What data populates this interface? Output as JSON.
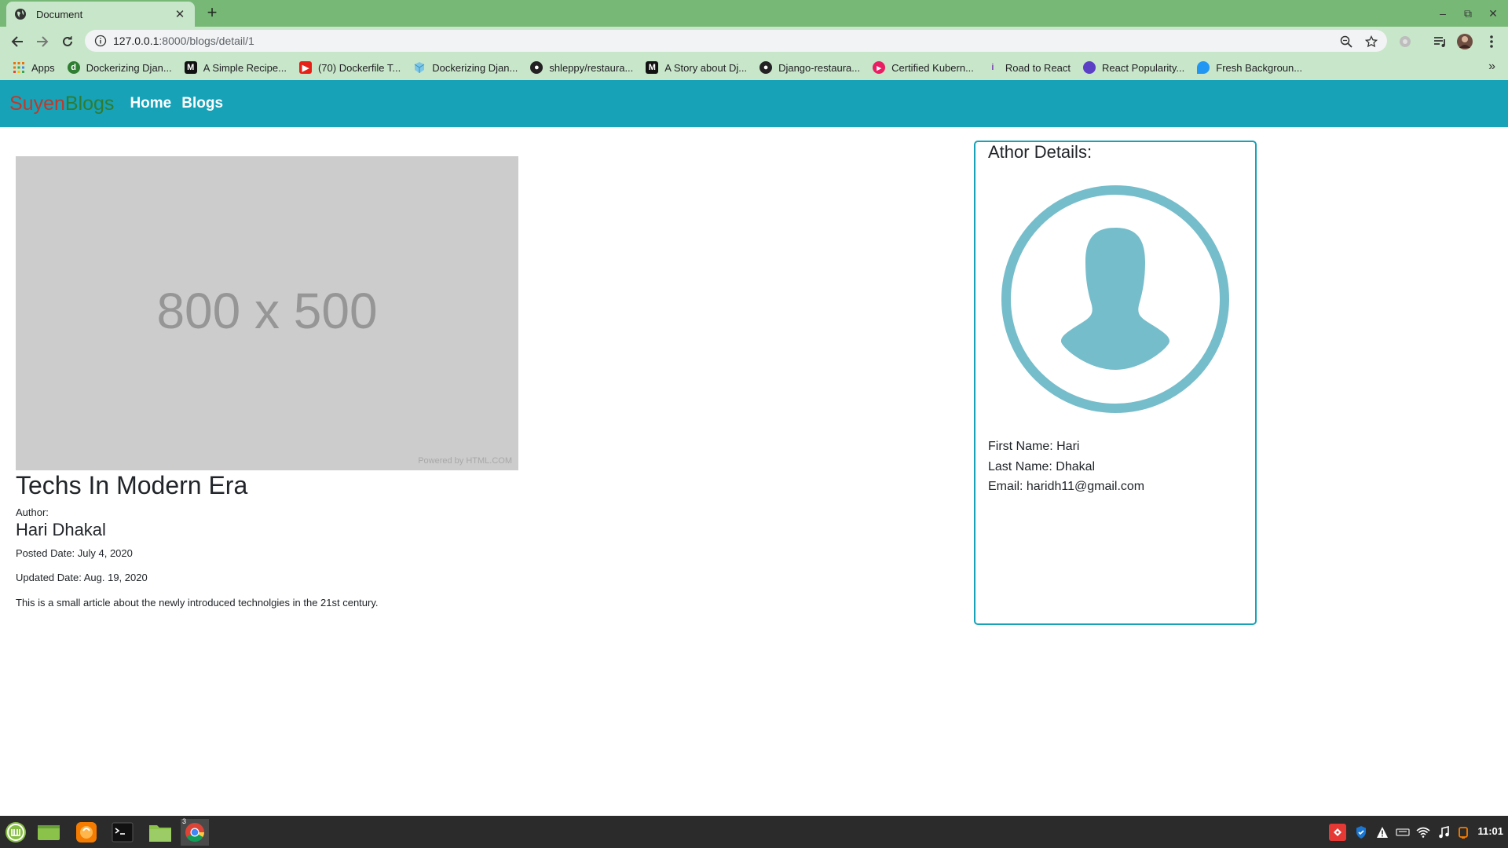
{
  "browser": {
    "tab_title": "Document",
    "url_host": "127.0.0.1",
    "url_rest": ":8000/blogs/detail/1",
    "bookmarks": [
      {
        "label": "Apps",
        "icon": "apps-grid-icon",
        "color": "#e8710a"
      },
      {
        "label": "Dockerizing Djan...",
        "icon": "green-logo-icon",
        "color": "#2e7d32"
      },
      {
        "label": "A Simple Recipe...",
        "icon": "medium-icon",
        "color": "#111111"
      },
      {
        "label": "(70) Dockerfile T...",
        "icon": "youtube-icon",
        "color": "#e62117"
      },
      {
        "label": "Dockerizing Djan...",
        "icon": "cube-icon",
        "color": "#4fa3d1"
      },
      {
        "label": "shleppy/restaura...",
        "icon": "github-icon",
        "color": "#222222"
      },
      {
        "label": "A Story about Dj...",
        "icon": "medium-icon",
        "color": "#111111"
      },
      {
        "label": "Django-restaura...",
        "icon": "github-icon",
        "color": "#222222"
      },
      {
        "label": "Certified Kubern...",
        "icon": "pink-circle-icon",
        "color": "#e91e63"
      },
      {
        "label": "Road to React",
        "icon": "figure-icon",
        "color": "#7b3fb4"
      },
      {
        "label": "React Popularity...",
        "icon": "purple-blob-icon",
        "color": "#5b3fc4"
      },
      {
        "label": "Fresh Backgroun...",
        "icon": "blue-drop-icon",
        "color": "#2196f3"
      }
    ]
  },
  "page": {
    "brand_part1": "Suyen",
    "brand_part2": "Blogs",
    "nav_home": "Home",
    "nav_blogs": "Blogs",
    "placeholder_text": "800 x 500",
    "placeholder_credit": "Powered by HTML.COM",
    "post_title": "Techs In Modern Era",
    "author_label": "Author:",
    "author_name": "Hari Dhakal",
    "posted_date": "Posted Date: July 4, 2020",
    "updated_date": "Updated Date: Aug. 19, 2020",
    "summary": "This is a small article about the newly introduced technolgies in the 21st century.",
    "author_card": {
      "title": "Athor Details:",
      "first_name": "First Name: Hari",
      "last_name": "Last Name: Dhakal",
      "email": "Email: haridh11@gmail.com"
    }
  },
  "taskbar": {
    "clock": "11:01",
    "chrome_badge": "3"
  },
  "colors": {
    "navbar": "#17a2b8",
    "brand_suyen": "#c0392b",
    "brand_blogs": "#2e7d32",
    "avatar": "#76bdcb",
    "tabbar": "#78b877",
    "toolbar": "#c8e6c9"
  }
}
